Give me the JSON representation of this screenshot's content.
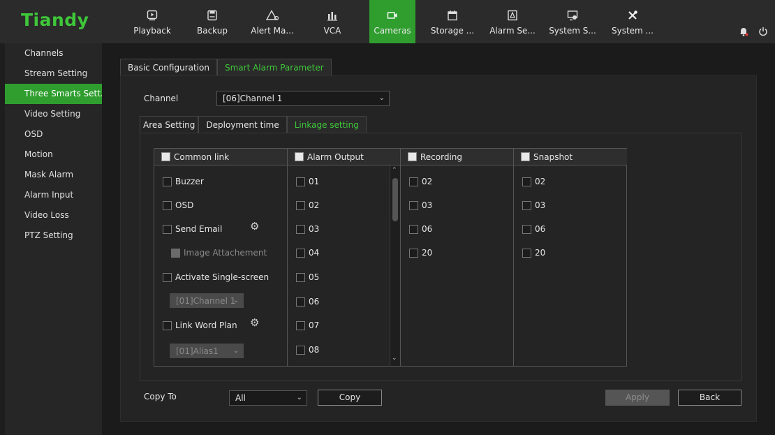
{
  "brand": {
    "logo": "Tiandy",
    "color": "#3fc73a"
  },
  "nav": [
    {
      "label": "Playback",
      "icon": "playback-icon"
    },
    {
      "label": "Backup",
      "icon": "backup-icon"
    },
    {
      "label": "Alert Ma...",
      "icon": "alert-icon"
    },
    {
      "label": "VCA",
      "icon": "vca-icon"
    },
    {
      "label": "Cameras",
      "icon": "camera-icon",
      "active": true
    },
    {
      "label": "Storage ...",
      "icon": "storage-icon"
    },
    {
      "label": "Alarm Se...",
      "icon": "alarm-icon"
    },
    {
      "label": "System S...",
      "icon": "system-settings-icon"
    },
    {
      "label": "System ...",
      "icon": "tools-icon"
    }
  ],
  "sidebar": {
    "items": [
      {
        "label": "Channels"
      },
      {
        "label": "Stream Setting"
      },
      {
        "label": "Three Smarts Sett...",
        "active": true
      },
      {
        "label": "Video Setting"
      },
      {
        "label": "OSD"
      },
      {
        "label": "Motion"
      },
      {
        "label": "Mask Alarm"
      },
      {
        "label": "Alarm Input"
      },
      {
        "label": "Video Loss"
      },
      {
        "label": "PTZ Setting"
      }
    ]
  },
  "tabs": {
    "basic": "Basic Configuration",
    "smart": "Smart Alarm Parameter"
  },
  "channel": {
    "label": "Channel",
    "value": "[06]Channel 1"
  },
  "subtabs": {
    "area": "Area Setting",
    "deployment": "Deployment time",
    "linkage": "Linkage setting"
  },
  "columns": {
    "common": "Common link",
    "alarm_output": "Alarm Output",
    "recording": "Recording",
    "snapshot": "Snapshot"
  },
  "common_links": {
    "buzzer": "Buzzer",
    "osd": "OSD",
    "send_email": "Send Email",
    "image_attachment": "Image Attachement",
    "single_screen": "Activate Single-screen",
    "single_screen_channel": "[01]Channel 1",
    "word_plan": "Link Word Plan",
    "word_plan_alias": "[01]Alias1"
  },
  "alarm_outputs": [
    "01",
    "02",
    "03",
    "04",
    "05",
    "06",
    "07",
    "08"
  ],
  "recording": [
    "02",
    "03",
    "06",
    "20"
  ],
  "snapshot": [
    "02",
    "03",
    "06",
    "20"
  ],
  "copy": {
    "label": "Copy To",
    "target": "All",
    "button": "Copy"
  },
  "buttons": {
    "apply": "Apply",
    "back": "Back"
  }
}
